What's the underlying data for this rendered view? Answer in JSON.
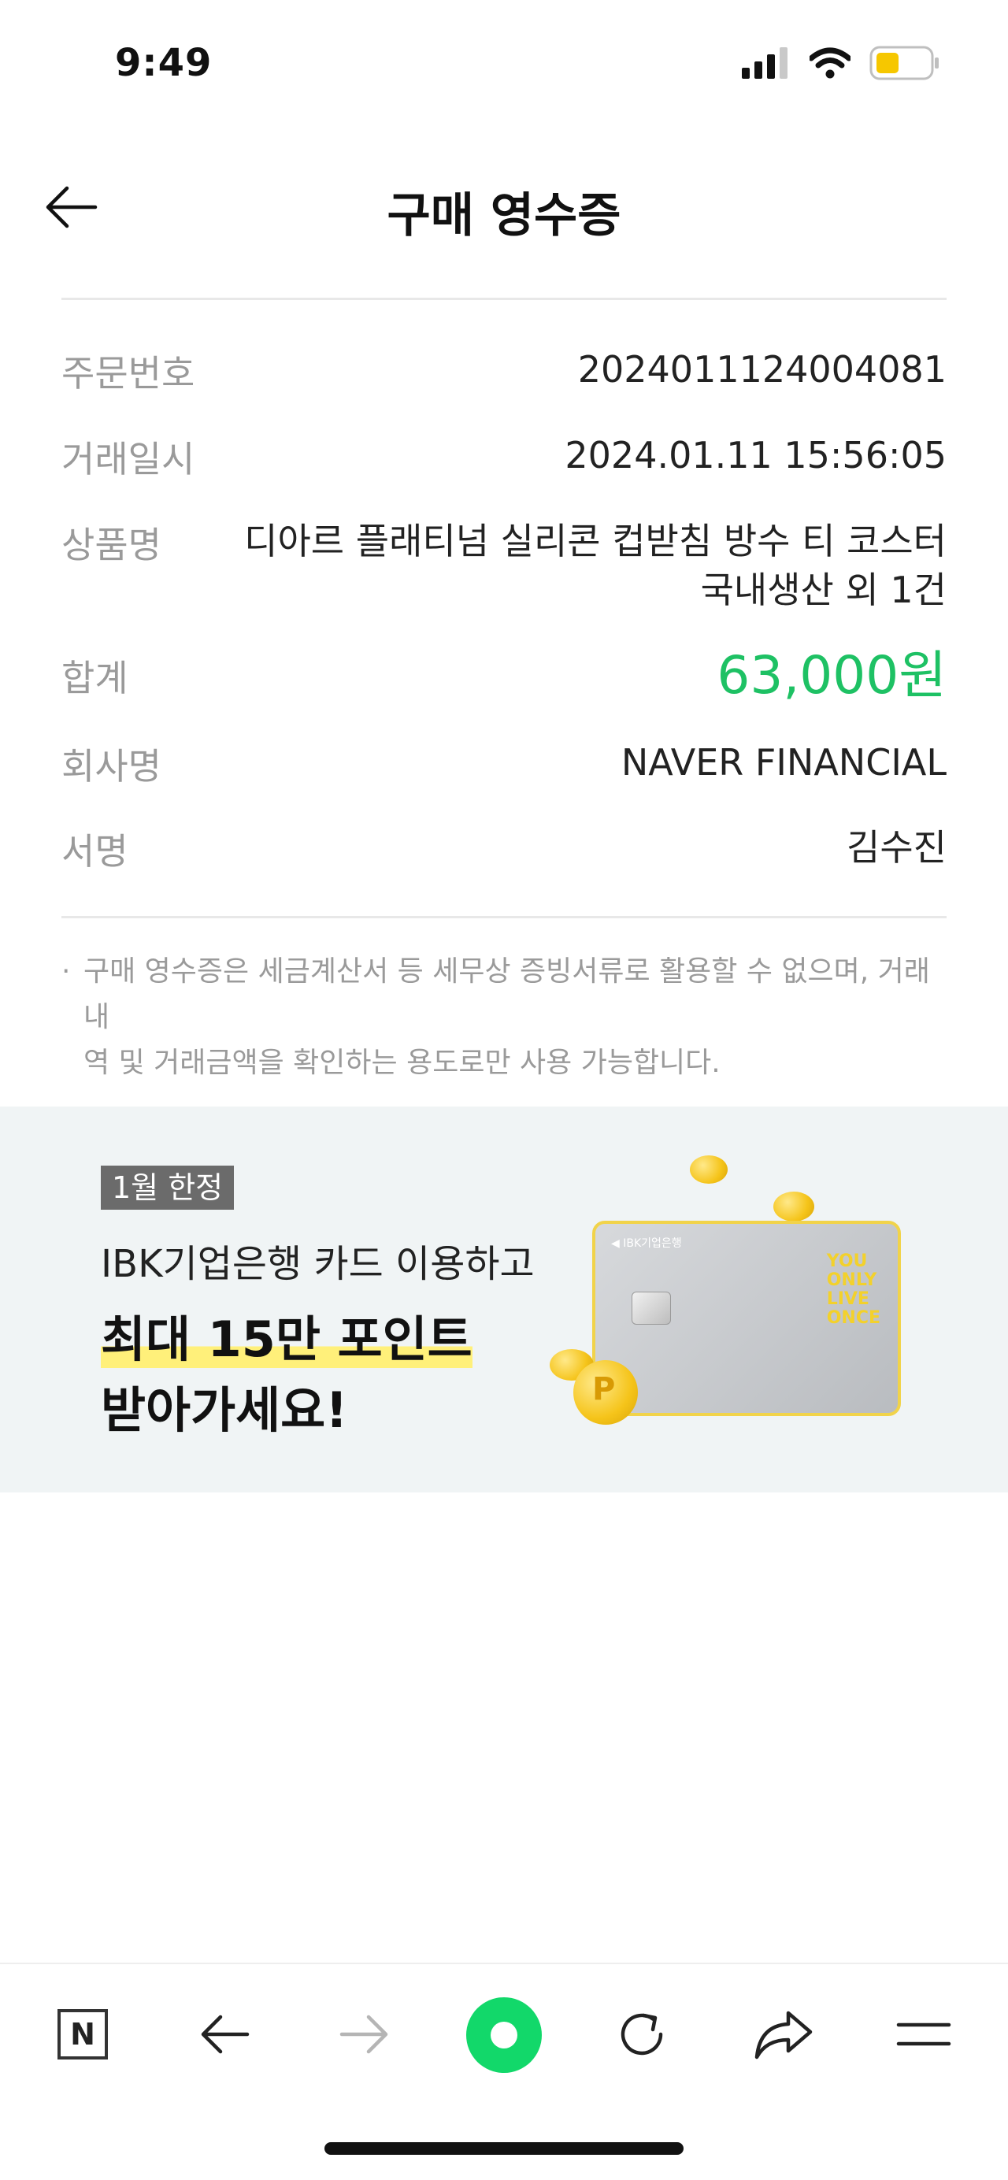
{
  "status": {
    "time": "9:49"
  },
  "header": {
    "title": "구매 영수증"
  },
  "receipt": {
    "rows": [
      {
        "label": "주문번호",
        "value": "2024011124004081"
      },
      {
        "label": "거래일시",
        "value": "2024.01.11 15:56:05"
      },
      {
        "label": "상품명",
        "value_line1": "디아르 플래티넘 실리콘 컵받침 방수 티 코스터",
        "value_line2": "국내생산 외 1건"
      },
      {
        "label": "합계",
        "value": "63,000원"
      },
      {
        "label": "회사명",
        "value": "NAVER FINANCIAL"
      },
      {
        "label": "서명",
        "value": "김수진"
      }
    ],
    "notice_dot": "·",
    "notice_line1": "구매 영수증은 세금계산서 등 세무상 증빙서류로 활용할 수 없으며, 거래내",
    "notice_line2": "역 및 거래금액을 확인하는 용도로만 사용 가능합니다."
  },
  "banner": {
    "badge": "1월 한정",
    "line1": "IBK기업은행 카드 이용하고",
    "line2": "최대 15만 포인트",
    "line3": "받아가세요!",
    "card_brand": "◀ IBK기업은행",
    "card_slogan": [
      "YOU",
      "ONLY",
      "LIVE",
      "ONCE"
    ],
    "coin_mark": "P"
  },
  "toolbar": {
    "naver_letter": "N",
    "items": [
      "naver-home",
      "back",
      "forward",
      "green-dot",
      "refresh",
      "share",
      "menu"
    ]
  },
  "colors": {
    "accent_green": "#1ec164",
    "banner_bg": "#f0f4f5",
    "highlight": "#fff07a"
  }
}
